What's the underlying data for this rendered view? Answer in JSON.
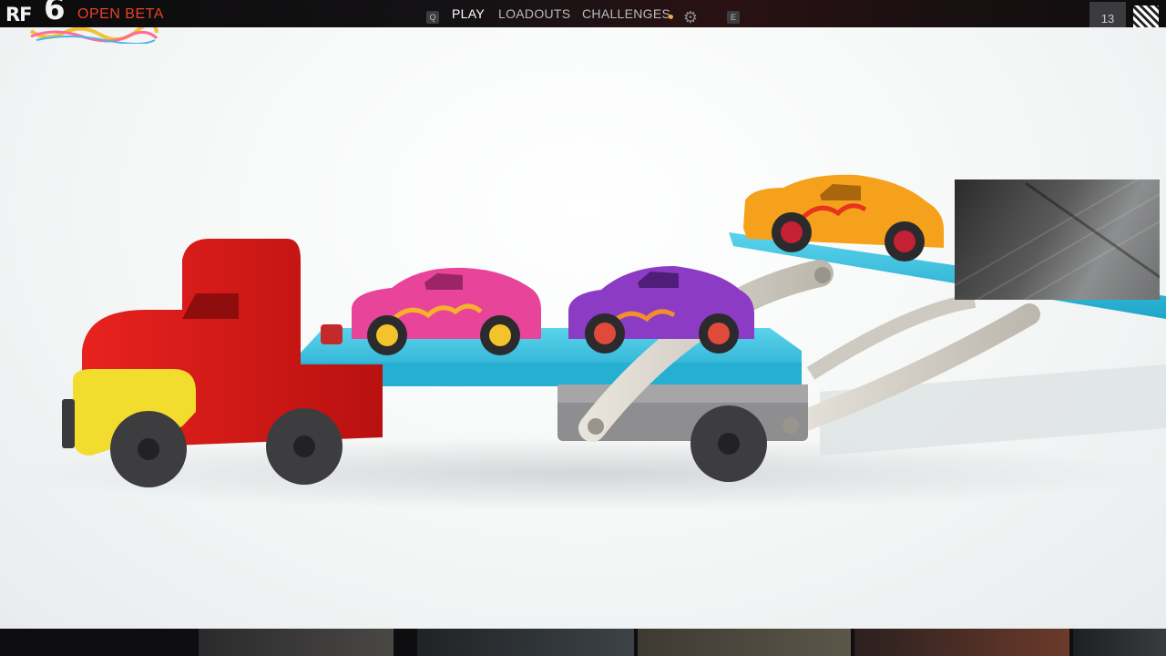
{
  "header": {
    "logo_text": "RF",
    "logo_number": "6",
    "edition": "OPEN BETA",
    "left_key": "Q",
    "right_key": "E",
    "tabs": [
      {
        "label": "PLAY",
        "active": true
      },
      {
        "label": "LOADOUTS",
        "active": false
      },
      {
        "label": "CHALLENGES",
        "active": false
      }
    ],
    "challenges_notification": true,
    "settings_icon": "gear-icon",
    "player_level": "13",
    "avatar_icon": "qr-avatar-icon"
  },
  "colors": {
    "accent": "#e8412b",
    "notification_dot": "#f2a93b",
    "truck_red": "#d8191c",
    "trailer_blue": "#3cc3e0"
  },
  "scene": {
    "description_icon": "toy-car-carrier-truck"
  },
  "webcam": {
    "icon": "webcam-overlay"
  }
}
